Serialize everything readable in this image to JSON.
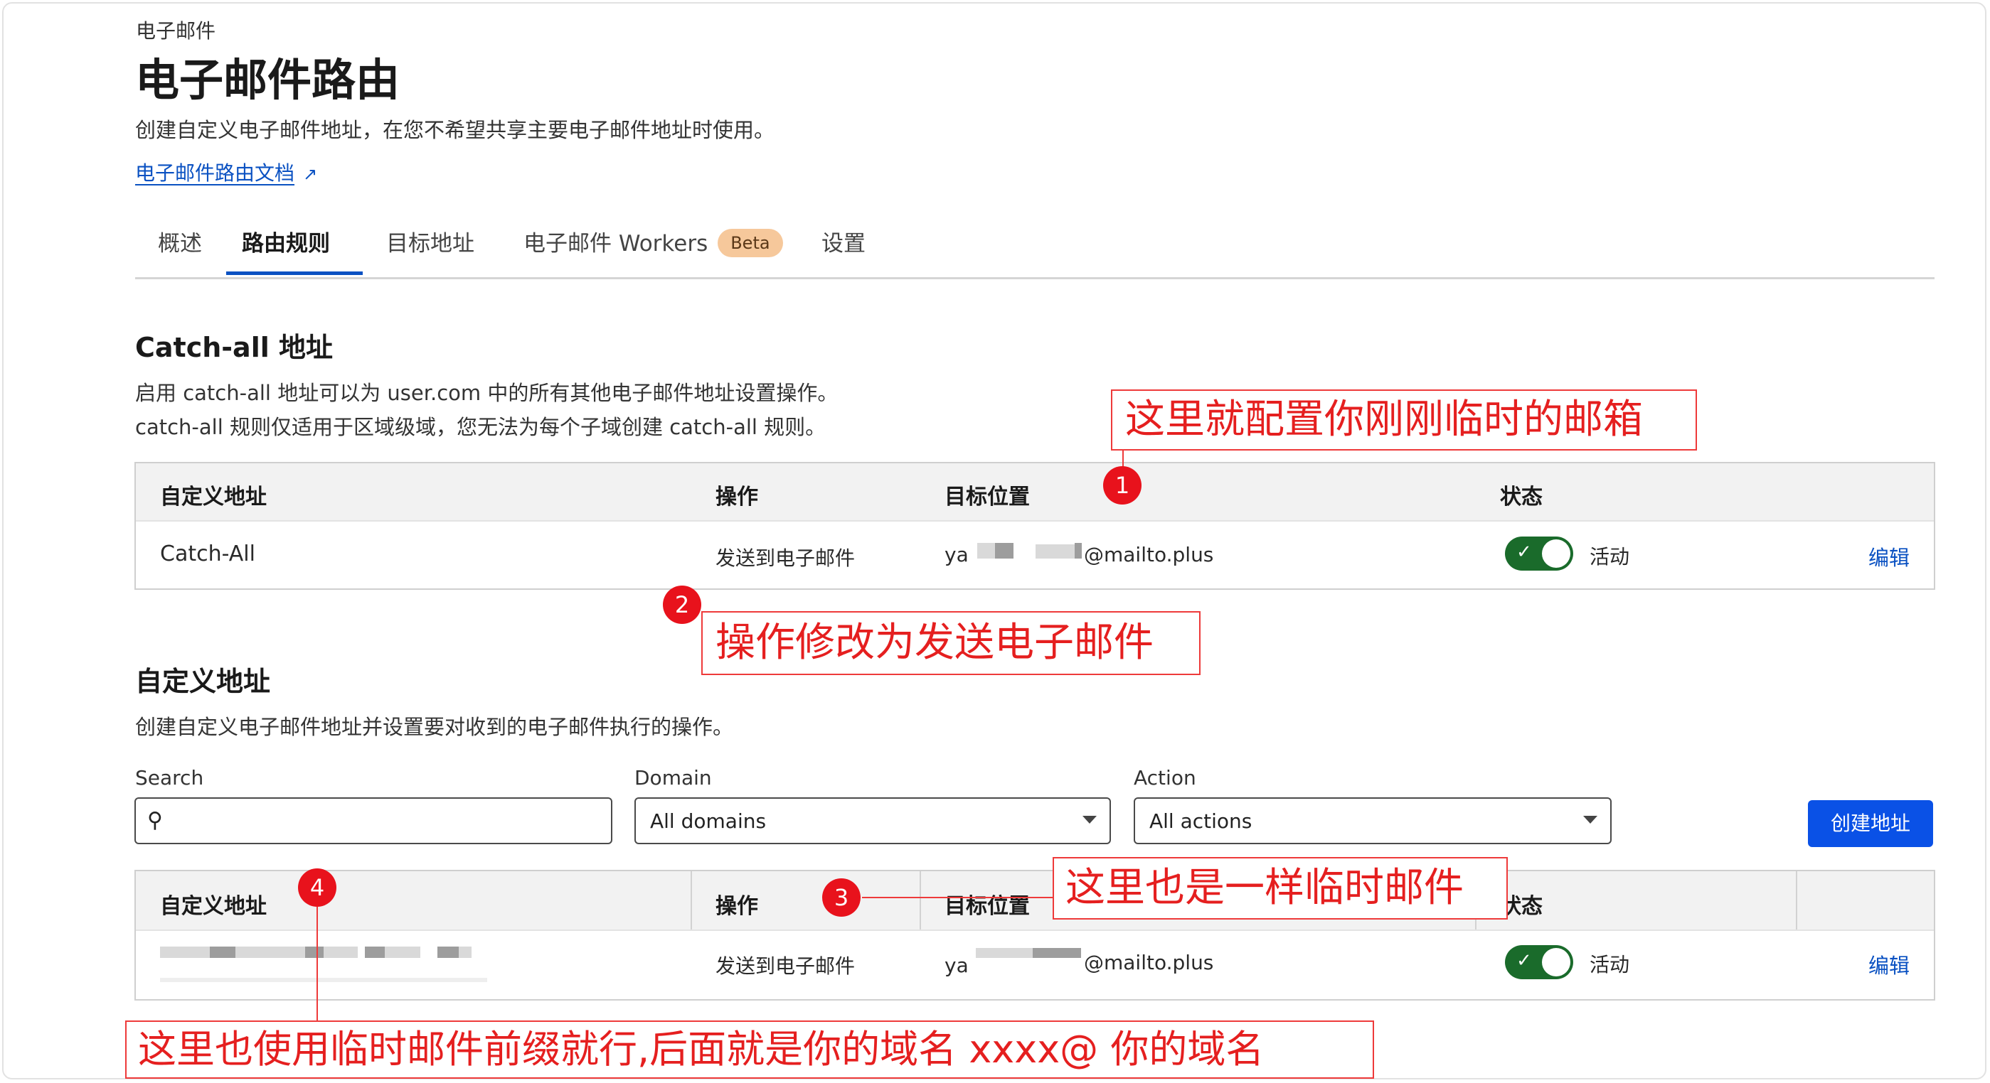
{
  "header": {
    "breadcrumb": "电子邮件",
    "title": "电子邮件路由",
    "description": "创建自定义电子邮件地址，在您不希望共享主要电子邮件地址时使用。",
    "doc_link": "电子邮件路由文档"
  },
  "tabs": [
    {
      "label": "概述",
      "active": false
    },
    {
      "label": "路由规则",
      "active": true
    },
    {
      "label": "目标地址",
      "active": false
    },
    {
      "label": "电子邮件 Workers",
      "badge": "Beta",
      "active": false
    },
    {
      "label": "设置",
      "active": false
    }
  ],
  "catch_all": {
    "title": "Catch-all 地址",
    "desc_line1": "启用 catch-all 地址可以为 user.com 中的所有其他电子邮件地址设置操作。",
    "desc_line2": "catch-all 规则仅适用于区域级域，您无法为每个子域创建 catch-all 规则。",
    "columns": [
      "自定义地址",
      "操作",
      "目标位置",
      "状态"
    ],
    "row": {
      "address": "Catch-All",
      "action": "发送到电子邮件",
      "dest_prefix": "ya",
      "dest_suffix": "@mailto.plus",
      "status": "活动",
      "edit": "编辑"
    }
  },
  "custom": {
    "title": "自定义地址",
    "desc": "创建自定义电子邮件地址并设置要对收到的电子邮件执行的操作。",
    "filters": {
      "search_label": "Search",
      "domain_label": "Domain",
      "domain_value": "All domains",
      "action_label": "Action",
      "action_value": "All actions"
    },
    "create_button": "创建地址",
    "columns": [
      "自定义地址",
      "操作",
      "目标位置",
      "状态"
    ],
    "row": {
      "action": "发送到电子邮件",
      "dest_prefix": "ya",
      "dest_suffix": "@mailto.plus",
      "status": "活动",
      "edit": "编辑"
    }
  },
  "annotations": {
    "a1": "这里就配置你刚刚临时的邮箱",
    "a2": "操作修改为发送电子邮件",
    "a3": "这里也是一样临时邮件",
    "a4": "这里也使用临时邮件前缀就行,后面就是你的域名 xxxx@ 你的域名",
    "badges": [
      "1",
      "2",
      "3",
      "4"
    ]
  },
  "colors": {
    "link": "#0a51c2",
    "toggle_on": "#1a6b2b",
    "primary_button": "#0a51e6",
    "annotation": "#e51f1f",
    "beta_badge": "#f6c89b"
  }
}
